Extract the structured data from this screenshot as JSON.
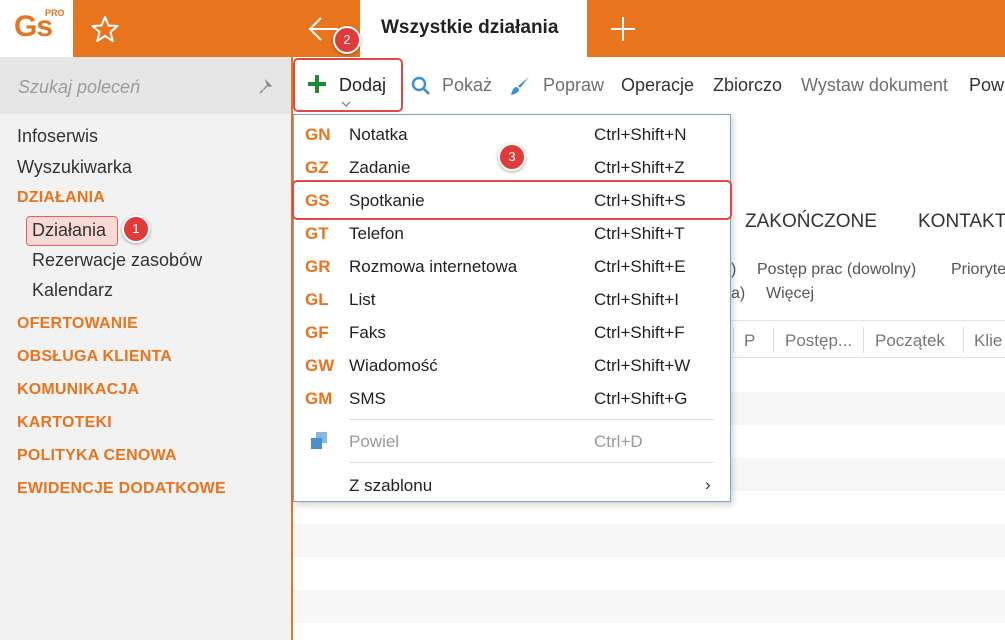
{
  "app": {
    "logo_text": "Gs",
    "logo_badge": "PRO",
    "active_tab": "Wszystkie działania",
    "accent": "#e8741e"
  },
  "sidebar": {
    "search_placeholder": "Szukaj poleceń",
    "items": [
      {
        "label": "Infoserwis",
        "kind": "item"
      },
      {
        "label": "Wyszukiwarka",
        "kind": "item"
      },
      {
        "label": "DZIAŁANIA",
        "kind": "section"
      },
      {
        "label": "Działania",
        "kind": "sub",
        "active": true
      },
      {
        "label": "Rezerwacje zasobów",
        "kind": "sub"
      },
      {
        "label": "Kalendarz",
        "kind": "sub"
      },
      {
        "label": "OFERTOWANIE",
        "kind": "section"
      },
      {
        "label": "OBSŁUGA KLIENTA",
        "kind": "section"
      },
      {
        "label": "KOMUNIKACJA",
        "kind": "section"
      },
      {
        "label": "KARTOTEKI",
        "kind": "section"
      },
      {
        "label": "POLITYKA CENOWA",
        "kind": "section"
      },
      {
        "label": "EWIDENCJE DODATKOWE",
        "kind": "section"
      }
    ]
  },
  "toolbar": {
    "add": "Dodaj",
    "show": "Pokaż",
    "fix": "Popraw",
    "operations": "Operacje",
    "summary": "Zbiorczo",
    "issue_document": "Wystaw dokument",
    "more": "Powi"
  },
  "content": {
    "tab_finished": "ZAKOŃCZONE",
    "tab_contacts": "KONTAKT",
    "filter_paren": ")",
    "filter_progress": "Postęp prac (dowolny)",
    "filter_priority": "Prioryte",
    "filter_a": "a)",
    "filter_more": "Więcej",
    "columns": [
      "P",
      "Postęp...",
      "Początek",
      "Klie"
    ]
  },
  "menu": {
    "items": [
      {
        "code": "GN",
        "label": "Notatka",
        "shortcut": "Ctrl+Shift+N"
      },
      {
        "code": "GZ",
        "label": "Zadanie",
        "shortcut": "Ctrl+Shift+Z"
      },
      {
        "code": "GS",
        "label": "Spotkanie",
        "shortcut": "Ctrl+Shift+S"
      },
      {
        "code": "GT",
        "label": "Telefon",
        "shortcut": "Ctrl+Shift+T"
      },
      {
        "code": "GR",
        "label": "Rozmowa internetowa",
        "shortcut": "Ctrl+Shift+E"
      },
      {
        "code": "GL",
        "label": "List",
        "shortcut": "Ctrl+Shift+I"
      },
      {
        "code": "GF",
        "label": "Faks",
        "shortcut": "Ctrl+Shift+F"
      },
      {
        "code": "GW",
        "label": "Wiadomość",
        "shortcut": "Ctrl+Shift+W"
      },
      {
        "code": "GM",
        "label": "SMS",
        "shortcut": "Ctrl+Shift+G"
      }
    ],
    "duplicate": {
      "label": "Powiel",
      "shortcut": "Ctrl+D"
    },
    "from_template": {
      "label": "Z szablonu",
      "arrow": "›"
    }
  },
  "badges": [
    "1",
    "2",
    "3"
  ]
}
